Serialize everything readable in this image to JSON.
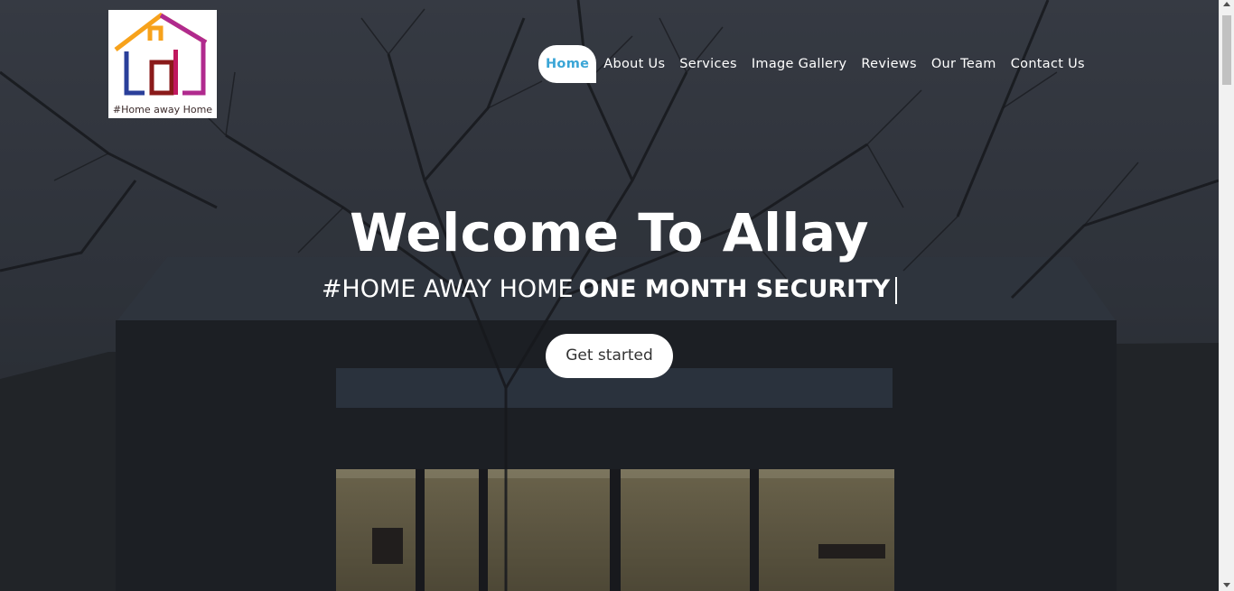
{
  "logo": {
    "caption": "#Home away Home"
  },
  "nav": {
    "items": [
      {
        "label": "Home",
        "active": true
      },
      {
        "label": "About Us"
      },
      {
        "label": "Services"
      },
      {
        "label": "Image Gallery"
      },
      {
        "label": "Reviews"
      },
      {
        "label": "Our Team"
      },
      {
        "label": "Contact Us"
      }
    ]
  },
  "hero": {
    "title": "Welcome To Allay",
    "subtitle_static": "#HOME AWAY HOME",
    "subtitle_typed": "ONE MONTH SECURITY",
    "cta_label": "Get started"
  },
  "colors": {
    "accent": "#3aa5d6"
  }
}
